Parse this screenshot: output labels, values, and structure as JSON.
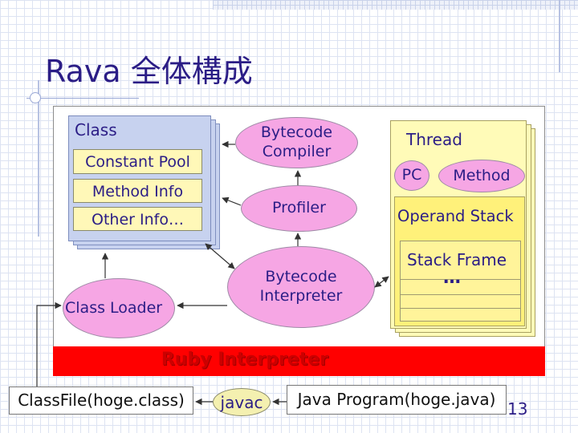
{
  "slide": {
    "title": "Rava 全体構成",
    "page_number": "13"
  },
  "diagram": {
    "class_card": {
      "title": "Class",
      "items": [
        "Constant Pool",
        "Method Info",
        "Other Info…"
      ]
    },
    "bytecode_compiler": "Bytecode\nCompiler",
    "profiler": "Profiler",
    "bytecode_interpreter": "Bytecode\nInterpreter",
    "class_loader": "Class Loader",
    "thread": {
      "title": "Thread",
      "pc": "PC",
      "method": "Method",
      "operand_stack": "Operand Stack",
      "stack_frame": "Stack Frame",
      "ellipsis": "…"
    },
    "ruby_interpreter": "Ruby Interpreter",
    "classfile": "ClassFile(hoge.class)",
    "javac": "javac",
    "java_program": "Java Program(hoge.java)"
  },
  "colors": {
    "title_text": "#2b1d86",
    "class_card": "#c7d2ef",
    "info_box": "#fff8b8",
    "ellipse": "#f6a6e4",
    "thread_card": "#fffbb8",
    "ruby_bar": "#ff0000"
  }
}
